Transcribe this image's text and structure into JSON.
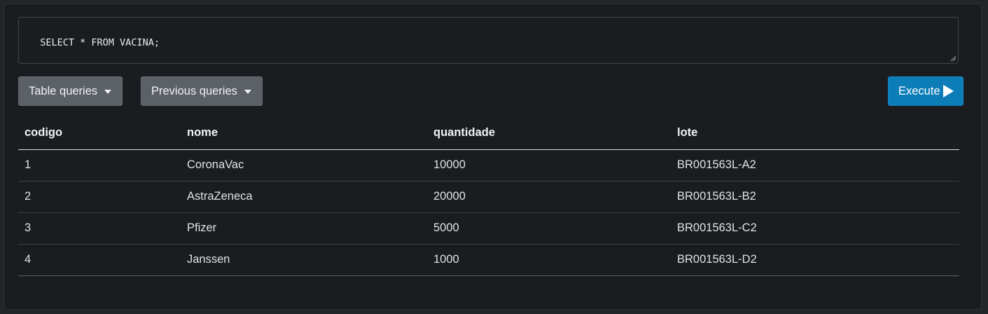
{
  "query": {
    "text": "SELECT * FROM VACINA;"
  },
  "toolbar": {
    "table_queries_label": "Table queries",
    "previous_queries_label": "Previous queries",
    "execute_label": "Execute"
  },
  "results": {
    "columns": [
      "codigo",
      "nome",
      "quantidade",
      "lote"
    ],
    "rows": [
      [
        "1",
        "CoronaVac",
        "10000",
        "BR001563L-A2"
      ],
      [
        "2",
        "AstraZeneca",
        "20000",
        "BR001563L-B2"
      ],
      [
        "3",
        "Pfizer",
        "5000",
        "BR001563L-C2"
      ],
      [
        "4",
        "Janssen",
        "1000",
        "BR001563L-D2"
      ]
    ]
  },
  "icons": {
    "dropdown": "caret-down-icon",
    "execute": "play-icon",
    "resize": "resize-grip-icon"
  },
  "colors": {
    "background": "#1b1c1f",
    "button_secondary": "#5b6167",
    "button_primary": "#0d7db8"
  }
}
